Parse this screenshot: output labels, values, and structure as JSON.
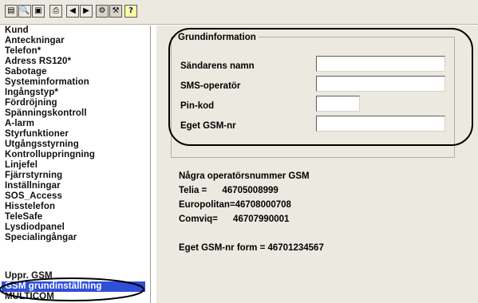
{
  "toolbar": {
    "buttons": [
      {
        "name": "new-doc-icon",
        "glyph": "▤"
      },
      {
        "name": "find-icon",
        "glyph": "🔍"
      },
      {
        "name": "save-icon",
        "glyph": "▣"
      },
      {
        "name": "print-icon",
        "glyph": "⎙"
      },
      {
        "name": "arrow-left-icon",
        "glyph": "◀"
      },
      {
        "name": "arrow-right-icon",
        "glyph": "▶"
      },
      {
        "name": "settings-icon",
        "glyph": "⚙"
      },
      {
        "name": "tools-icon",
        "glyph": "⚒"
      },
      {
        "name": "help-icon",
        "glyph": "?"
      }
    ]
  },
  "sidebar": {
    "items": [
      "Kund",
      "Anteckningar",
      "Telefon*",
      "Adress RS120*",
      "Sabotage",
      "Systeminformation",
      "Ingångstyp*",
      "Fördröjning",
      "Spänningskontroll",
      "A-larm",
      "Styrfunktioner",
      "Utgångsstyrning",
      "Kontrolluppringning",
      "Linjefel",
      "Fjärrstyrning",
      "Inställningar",
      "SOS_Access",
      "Hisstelefon",
      "TeleSafe",
      "Lysdiodpanel",
      "Specialingångar",
      "Uppr. GSM",
      "GSM grundinställning",
      "MULTICOM"
    ],
    "selected_index": 22,
    "selected_color": "#2f4fd6"
  },
  "group": {
    "title": "Grundinformation",
    "fields": [
      {
        "label": "Sändarens namn",
        "value": ""
      },
      {
        "label": "SMS-operatör",
        "value": ""
      },
      {
        "label": "Pin-kod",
        "value": ""
      },
      {
        "label": "Eget GSM-nr",
        "value": ""
      }
    ]
  },
  "info": {
    "heading": "Några operatörsnummer GSM",
    "lines": [
      "Telia =      46705008999",
      "Europolitan=46708000708",
      "Comviq=      46707990001"
    ],
    "own_format": "Eget GSM-nr form = 46701234567"
  },
  "colors": {
    "panel_bg": "#ece9e1",
    "annotation_outline": "#000000"
  }
}
